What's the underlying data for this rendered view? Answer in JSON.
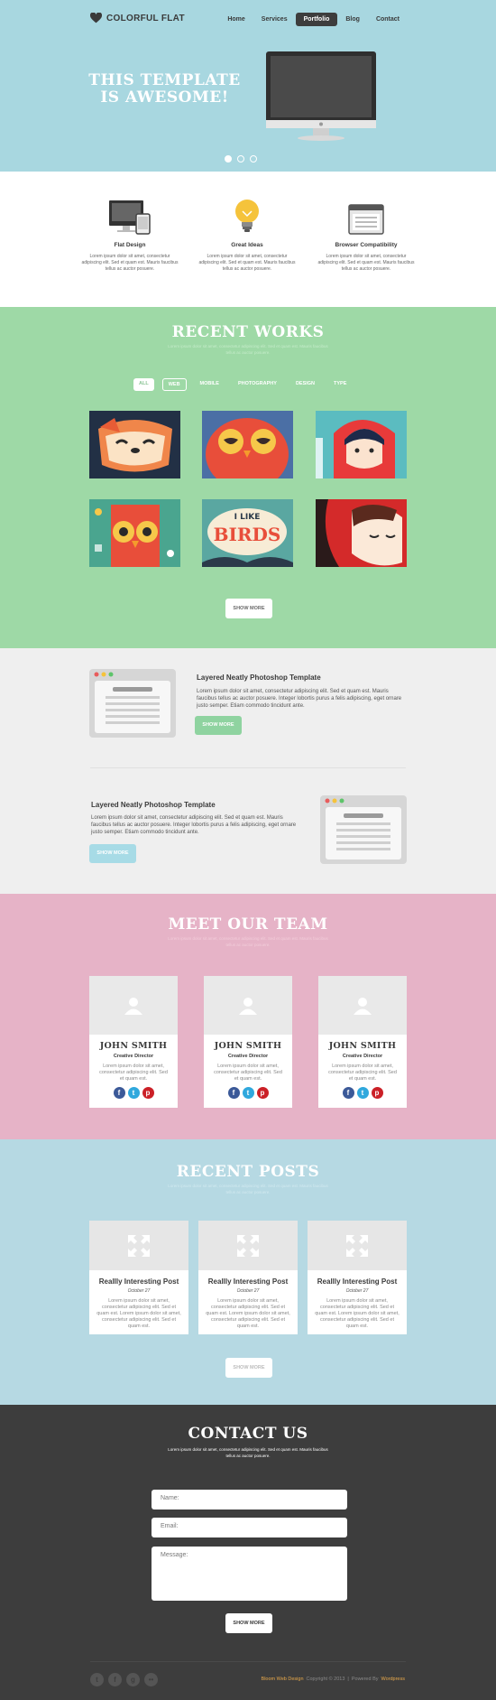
{
  "logo": {
    "text": "COLORFUL FLAT"
  },
  "nav": {
    "items": [
      "Home",
      "Services",
      "Portfolio",
      "Blog",
      "Contact"
    ],
    "active": "Portfolio"
  },
  "hero": {
    "title_line1": "THIS TEMPLATE",
    "title_line2": "IS AWESOME!",
    "slides": 3,
    "active_slide": 1
  },
  "features": [
    {
      "icon": "devices-icon",
      "title": "Flat Design",
      "text": "Lorem ipsum dolor sit amet, consectetur adipiscing elit. Sed et quam est. Mauris faucibus tellus ac auctor posuere."
    },
    {
      "icon": "lightbulb-icon",
      "title": "Great Ideas",
      "text": "Lorem ipsum dolor sit amet, consectetur adipiscing elit. Sed et quam est. Mauris faucibus tellus ac auctor posuere."
    },
    {
      "icon": "browser-icon",
      "title": "Browser Compatibility",
      "text": "Lorem ipsum dolor sit amet, consectetur adipiscing elit. Sed et quam est. Mauris faucibus tellus ac auctor posuere."
    }
  ],
  "works": {
    "title": "RECENT WORKS",
    "subtitle": "Lorem ipsum dolor sit amet, consectetur adipiscing elit. Sed et quam est. Mauris faucibus tellus ac auctor posuere.",
    "filters": [
      "ALL",
      "WEB",
      "MOBILE",
      "PHOTOGRAPHY",
      "DESIGN",
      "TYPE"
    ],
    "tiles": [
      "fox-illustration",
      "owl-illustration",
      "red-hood-girl-illustration",
      "pattern-owl-illustration",
      "i-like-birds-illustration",
      "red-girl-illustration"
    ],
    "tile_text": {
      "line1": "I LIKE",
      "line2": "BIRDS"
    },
    "button": "SHOW MORE"
  },
  "templates": [
    {
      "title": "Layered Neatly Photoshop Template",
      "text": "Lorem ipsum dolor sit amet, consectetur adipiscing elit. Sed et quam est. Mauris faucibus tellus ac auctor posuere. Integer lobortis purus a felis adipiscing, eget ornare justo semper. Etiam commodo tincidunt ante.",
      "button": "SHOW MORE"
    },
    {
      "title": "Layered Neatly Photoshop Template",
      "text": "Lorem ipsum dolor sit amet, consectetur adipiscing elit. Sed et quam est. Mauris faucibus tellus ac auctor posuere. Integer lobortis purus a felis adipiscing, eget ornare justo semper. Etiam commodo tincidunt ante.",
      "button": "SHOW MORE"
    }
  ],
  "team": {
    "title": "MEET OUR TEAM",
    "subtitle": "Lorem ipsum dolor sit amet, consectetur adipiscing elit. Sed et quam est. Mauris faucibus tellus ac auctor posuere.",
    "members": [
      {
        "name": "JOHN SMITH",
        "role": "Creative Director",
        "text": "Lorem ipsum dolor sit amet, consectetur adipiscing elit. Sed et quam est."
      },
      {
        "name": "JOHN SMITH",
        "role": "Creative Director",
        "text": "Lorem ipsum dolor sit amet, consectetur adipiscing elit. Sed et quam est."
      },
      {
        "name": "JOHN SMITH",
        "role": "Creative Director",
        "text": "Lorem ipsum dolor sit amet, consectetur adipiscing elit. Sed et quam est."
      }
    ],
    "social": [
      {
        "icon": "facebook-icon",
        "glyph": "f",
        "color": "#3b5998"
      },
      {
        "icon": "twitter-icon",
        "glyph": "t",
        "color": "#2fa8dd"
      },
      {
        "icon": "pinterest-icon",
        "glyph": "p",
        "color": "#cb2027"
      }
    ]
  },
  "posts": {
    "title": "RECENT POSTS",
    "subtitle": "Lorem ipsum dolor sit amet, consectetur adipiscing elit. Sed et quam est. Mauris faucibus tellus ac auctor posuere.",
    "items": [
      {
        "title": "Reallly Interesting Post",
        "date": "October 27",
        "text": "Lorem ipsum dolor sit amet, consectetur adipiscing elit. Sed et quam est. Lorem ipsum dolor sit amet, consectetur adipiscing elit. Sed et quam est."
      },
      {
        "title": "Reallly Interesting Post",
        "date": "October 27",
        "text": "Lorem ipsum dolor sit amet, consectetur adipiscing elit. Sed et quam est. Lorem ipsum dolor sit amet, consectetur adipiscing elit. Sed et quam est."
      },
      {
        "title": "Reallly Interesting Post",
        "date": "October 27",
        "text": "Lorem ipsum dolor sit amet, consectetur adipiscing elit. Sed et quam est. Lorem ipsum dolor sit amet, consectetur adipiscing elit. Sed et quam est."
      }
    ],
    "button": "SHOW MORE"
  },
  "contact": {
    "title": "CONTACT US",
    "subtitle": "Lorem ipsum dolor sit amet, consectetur adipiscing elit. Sed et quam est. Mauris faucibus tellus ac auctor posuere.",
    "name_placeholder": "Name:",
    "email_placeholder": "Email:",
    "message_placeholder": "Message:",
    "button": "SHOW MORE"
  },
  "footer": {
    "social": [
      {
        "icon": "twitter-icon",
        "glyph": "t"
      },
      {
        "icon": "facebook-icon",
        "glyph": "f"
      },
      {
        "icon": "google-plus-icon",
        "glyph": "g"
      },
      {
        "icon": "flickr-icon",
        "glyph": "••"
      }
    ],
    "brand": "Bloom Web Design",
    "copyright": "Copyright © 2013",
    "separator": "|",
    "powered": "Powered By",
    "platform": "Wordpress"
  },
  "colors": {
    "hero": "#a8d7e0",
    "works": "#9ed9a6",
    "team": "#e6b3c7",
    "posts": "#b6d9e3",
    "contact": "#3d3d3d",
    "accent_green": "#8fd3a0",
    "accent_blue": "#a7dbe6",
    "footer_link": "#e8a94b"
  }
}
